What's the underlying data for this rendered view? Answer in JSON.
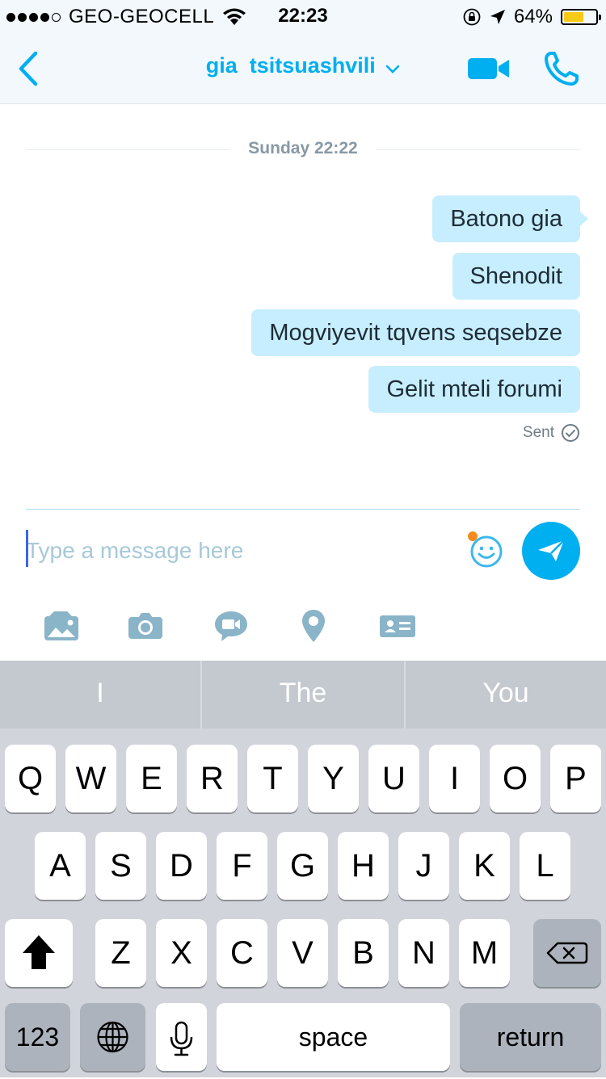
{
  "status_bar": {
    "carrier": "GEO-GEOCELL",
    "time": "22:23",
    "battery_percent": "64%",
    "battery_level": 0.64,
    "signal_bars_filled": 4,
    "signal_bars_total": 5
  },
  "header": {
    "contact_name": "gia  tsitsuashvili",
    "accent_color": "#00aff0",
    "icons": [
      "back-chevron-icon",
      "chevron-down-icon",
      "video-camera-icon",
      "phone-icon"
    ]
  },
  "chat": {
    "date_label": "Sunday 22:22",
    "messages": [
      {
        "text": "Batono gia"
      },
      {
        "text": "Shenodit"
      },
      {
        "text": "Mogviyevit tqvens seqsebze"
      },
      {
        "text": "Gelit mteli forumi"
      }
    ],
    "status": "Sent"
  },
  "composer": {
    "placeholder": "Type a message here",
    "value": "",
    "toolbar_icons": [
      "media-gallery-icon",
      "camera-icon",
      "video-message-icon",
      "location-pin-icon",
      "contact-card-icon"
    ]
  },
  "keyboard": {
    "suggestions": [
      "I",
      "The",
      "You"
    ],
    "row1": [
      "Q",
      "W",
      "E",
      "R",
      "T",
      "Y",
      "U",
      "I",
      "O",
      "P"
    ],
    "row2": [
      "A",
      "S",
      "D",
      "F",
      "G",
      "H",
      "J",
      "K",
      "L"
    ],
    "row3": [
      "Z",
      "X",
      "C",
      "V",
      "B",
      "N",
      "M"
    ],
    "numbers_label": "123",
    "space_label": "space",
    "return_label": "return"
  }
}
